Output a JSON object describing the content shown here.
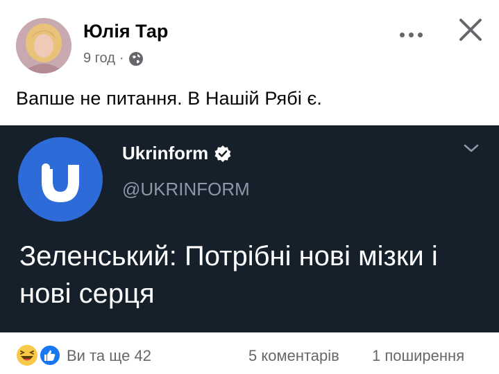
{
  "post": {
    "author": "Юлія Тар",
    "time": "9 год",
    "separator": "·",
    "privacy_icon": "globe-icon",
    "text": "Вапше не питання. В Нашій Рябі є."
  },
  "embed": {
    "name": "Ukrinform",
    "handle": "@UKRINFORM",
    "text": "Зеленський: Потрібні нові мізки і нові серця",
    "background": "#15202b",
    "logo_color": "#2d6bd8"
  },
  "footer": {
    "reactions_label": "Ви та ще 42",
    "comments_label": "5 коментарів",
    "shares_label": "1 поширення"
  }
}
